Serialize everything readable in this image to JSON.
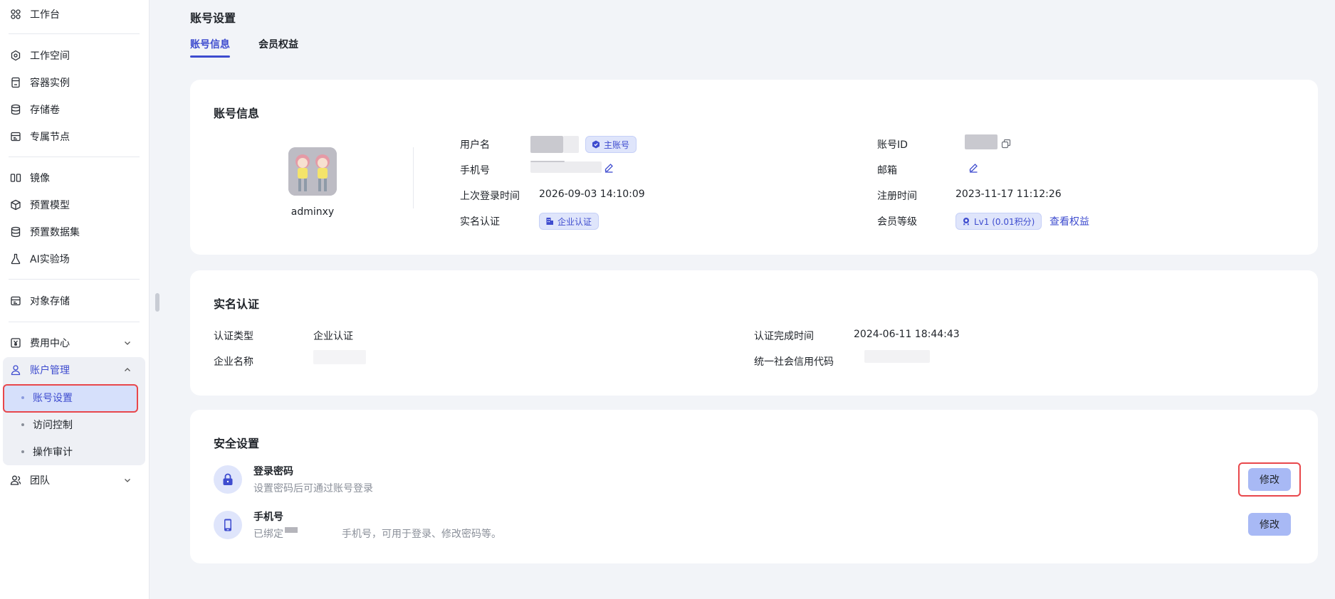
{
  "sidebar": {
    "items": [
      {
        "label": "工作台",
        "icon": "workbench-icon"
      },
      {
        "label": "工作空间",
        "icon": "workspace-icon"
      },
      {
        "label": "容器实例",
        "icon": "container-icon"
      },
      {
        "label": "存储卷",
        "icon": "storage-icon"
      },
      {
        "label": "专属节点",
        "icon": "node-icon"
      },
      {
        "label": "镜像",
        "icon": "image-icon"
      },
      {
        "label": "预置模型",
        "icon": "model-icon"
      },
      {
        "label": "预置数据集",
        "icon": "dataset-icon"
      },
      {
        "label": "AI实验场",
        "icon": "lab-icon"
      },
      {
        "label": "对象存储",
        "icon": "object-storage-icon"
      },
      {
        "label": "费用中心",
        "icon": "billing-icon"
      },
      {
        "label": "账户管理",
        "icon": "account-icon"
      },
      {
        "label": "团队",
        "icon": "team-icon"
      }
    ],
    "account_sub": [
      "账号设置",
      "访问控制",
      "操作审计"
    ],
    "active_color": "#3e4ccf"
  },
  "page": {
    "title": "账号设置",
    "tabs": [
      "账号信息",
      "会员权益"
    ],
    "active_tab": 0
  },
  "account_info": {
    "title": "账号信息",
    "username": "adminxy",
    "labels": {
      "username": "用户名",
      "phone": "手机号",
      "last_login": "上次登录时间",
      "verification": "实名认证",
      "account_id": "账号ID",
      "email": "邮箱",
      "register_time": "注册时间",
      "member_level": "会员等级"
    },
    "main_account_tag": "主账号",
    "last_login": "2026-09-03 14:10:09",
    "verification_tag": "企业认证",
    "register_time": "2023-11-17 11:12:26",
    "level_tag": "Lv1 (0.01积分)",
    "view_benefits": "查看权益"
  },
  "verification": {
    "title": "实名认证",
    "labels": {
      "type": "认证类型",
      "company": "企业名称",
      "done_time": "认证完成时间",
      "credit_code": "统一社会信用代码"
    },
    "type": "企业认证",
    "done_time": "2024-06-11 18:44:43"
  },
  "security": {
    "title": "安全设置",
    "items": [
      {
        "title": "登录密码",
        "desc": "设置密码后可通过账号登录",
        "button": "修改",
        "icon": "lock-icon"
      },
      {
        "title": "手机号",
        "desc_prefix": "已绑定",
        "desc_suffix": "手机号，可用于登录、修改密码等。",
        "button": "修改",
        "icon": "phone-icon"
      }
    ]
  },
  "colors": {
    "accent": "#3e4ccf",
    "tag_bg": "#dfe5fb",
    "button_bg": "#a8b9f5",
    "highlight": "#e8474b"
  }
}
